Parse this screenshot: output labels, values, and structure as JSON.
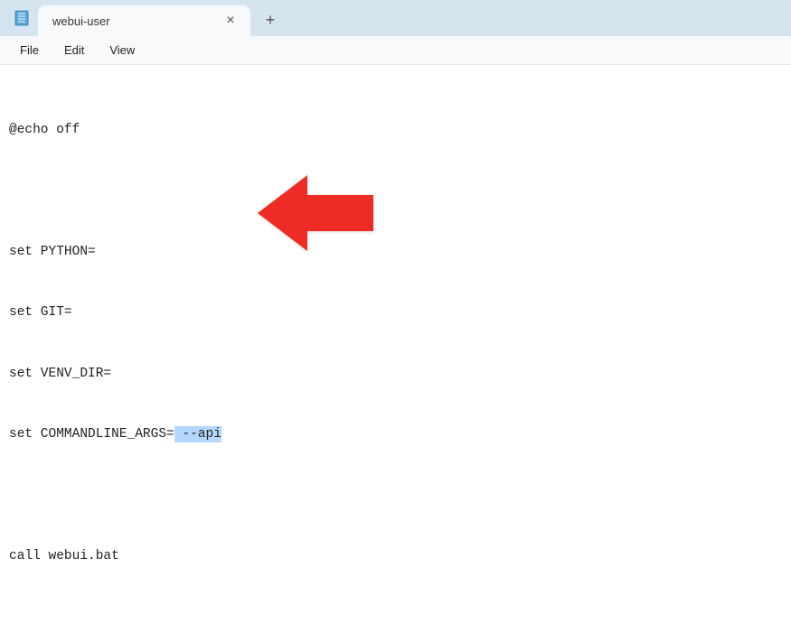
{
  "titlebar": {
    "tab_title": "webui-user",
    "close_glyph": "×",
    "new_tab_glyph": "+"
  },
  "menubar": {
    "file": "File",
    "edit": "Edit",
    "view": "View"
  },
  "editor": {
    "line1": "@echo off",
    "line2": "",
    "line3": "set PYTHON=",
    "line4": "set GIT=",
    "line5": "set VENV_DIR=",
    "line6_prefix": "set COMMANDLINE_ARGS=",
    "line6_highlight": " --api",
    "line7": "",
    "line8": "call webui.bat"
  },
  "colors": {
    "titlebar_bg": "#d5e5f0",
    "tab_bg": "#f7f9fb",
    "highlight_bg": "#b3d7ff",
    "arrow_fill": "#ee2b24"
  }
}
